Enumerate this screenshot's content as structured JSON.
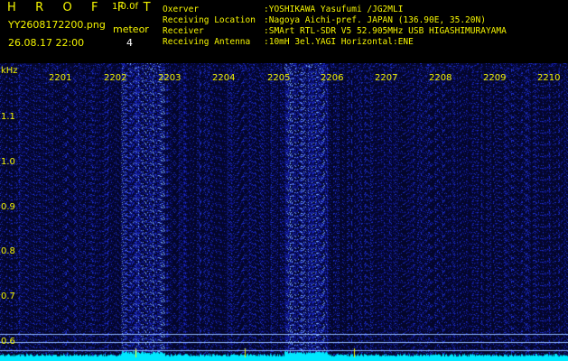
{
  "header": {
    "app_title": "H R O F F T",
    "version": "1.0.0f",
    "filename": "YY2608172200.png",
    "meteor_label": "meteor",
    "meteor_count": "4",
    "datetime": "26.08.17 22:00",
    "info": [
      {
        "key": "Oxerver",
        "value": ":YOSHIKAWA Yasufumi /JG2MLI"
      },
      {
        "key": "Receiving Location",
        "value": ":Nagoya Aichi-pref. JAPAN (136.90E, 35.20N)"
      },
      {
        "key": "Receiver",
        "value": ":SMArt RTL-SDR V5 52.905MHz USB HIGASHIMURAYAMA"
      },
      {
        "key": "Receiving Antenna",
        "value": ":10mH 3el.YAGI Horizontal:ENE"
      }
    ]
  },
  "spectrogram": {
    "y_unit": "kHz",
    "x_ticks": [
      "2201",
      "2202",
      "2203",
      "2204",
      "2205",
      "2206",
      "2207",
      "2208",
      "2209",
      "2210"
    ],
    "y_ticks": [
      "1.1",
      "1.0",
      "0.9",
      "0.8",
      "0.7",
      "0.6"
    ],
    "bright_bands": [
      {
        "from_min": "2202",
        "to_min": "2203",
        "start_frac": 0.4,
        "end_frac": 0.2
      },
      {
        "from_min": "2205",
        "to_min": "2206",
        "start_frac": 0.4,
        "end_frac": 0.3
      }
    ],
    "colors": {
      "text": "#f4f400",
      "background": "#000000",
      "noise": "#1a20c8",
      "cyan": "#00e8ff"
    }
  }
}
